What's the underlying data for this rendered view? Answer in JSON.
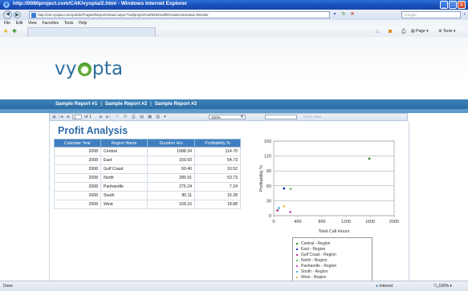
{
  "window": {
    "title": "http://0080project.com/CAK/vyopta/2.html - Windows Internet Explorer",
    "controls": [
      "_",
      "□",
      "X"
    ]
  },
  "address_bar": {
    "url": "http://vsi.vyopta.com/public/Pages/ReportViewer.aspx?%2fproject%2fSDN%3fRs%3aCommand=Render",
    "search_placeholder": "Google"
  },
  "menu": [
    "File",
    "Edit",
    "View",
    "Favorites",
    "Tools",
    "Help"
  ],
  "toolbar": {
    "page_label": "Page",
    "tools_label": "Tools"
  },
  "brand": {
    "logo_pre": "vy",
    "logo_post": "pta"
  },
  "nav": {
    "links": [
      "Sample Report #1",
      "Sample Report #2",
      "Sample Report #3"
    ],
    "separator": "|"
  },
  "report_toolbar": {
    "page_current": "1",
    "page_total": "of 1",
    "zoom": "100%",
    "find_label": "Find | Next"
  },
  "report": {
    "title": "Profit Analysis",
    "columns": [
      "Calendar Year",
      "Region Name",
      "Duration Hrs",
      "Profitability %"
    ],
    "rows": [
      [
        "2008",
        "Central",
        "1588.34",
        "114.70"
      ],
      [
        "2008",
        "East",
        "169.93",
        "54.73"
      ],
      [
        "2008",
        "Gulf Coast",
        "60.40",
        "10.52"
      ],
      [
        "2008",
        "North",
        "280.91",
        "53.73"
      ],
      [
        "2008",
        "Panhandle",
        "275.24",
        "7.24"
      ],
      [
        "2008",
        "South",
        "85.11",
        "15.28"
      ],
      [
        "2008",
        "West",
        "169.16",
        "18.88"
      ]
    ]
  },
  "chart_data": {
    "type": "scatter",
    "title": "",
    "xlabel": "Total Call Hours",
    "ylabel": "Profitability %",
    "xlim": [
      0,
      2000
    ],
    "ylim": [
      0,
      150
    ],
    "xticks": [
      0,
      400,
      800,
      1200,
      1600,
      2000
    ],
    "yticks": [
      0,
      30,
      60,
      90,
      120,
      150
    ],
    "grid": "horizontal",
    "legend_position": "bottom",
    "series": [
      {
        "name": "Central - Region",
        "color": "#2e8b22",
        "x": [
          1588.34
        ],
        "y": [
          114.7
        ]
      },
      {
        "name": "East - Region",
        "color": "#2233cc",
        "x": [
          169.93
        ],
        "y": [
          54.73
        ]
      },
      {
        "name": "Gulf Coast - Region",
        "color": "#b03090",
        "x": [
          60.4
        ],
        "y": [
          10.52
        ]
      },
      {
        "name": "North - Region",
        "color": "#66bb66",
        "x": [
          280.91
        ],
        "y": [
          53.73
        ]
      },
      {
        "name": "Panhandle - Region",
        "color": "#cc44cc",
        "x": [
          275.24
        ],
        "y": [
          7.24
        ]
      },
      {
        "name": "South - Region",
        "color": "#55aadd",
        "x": [
          85.11
        ],
        "y": [
          15.28
        ]
      },
      {
        "name": "West - Region",
        "color": "#e0c040",
        "x": [
          169.16
        ],
        "y": [
          18.88
        ]
      }
    ]
  },
  "status": {
    "left": "Done",
    "zone": "Internet",
    "zoom": "100%"
  },
  "colors": {
    "accent": "#2e6aa7",
    "nav_band": "#2a6ca3",
    "table_header": "#3f7fbf"
  }
}
